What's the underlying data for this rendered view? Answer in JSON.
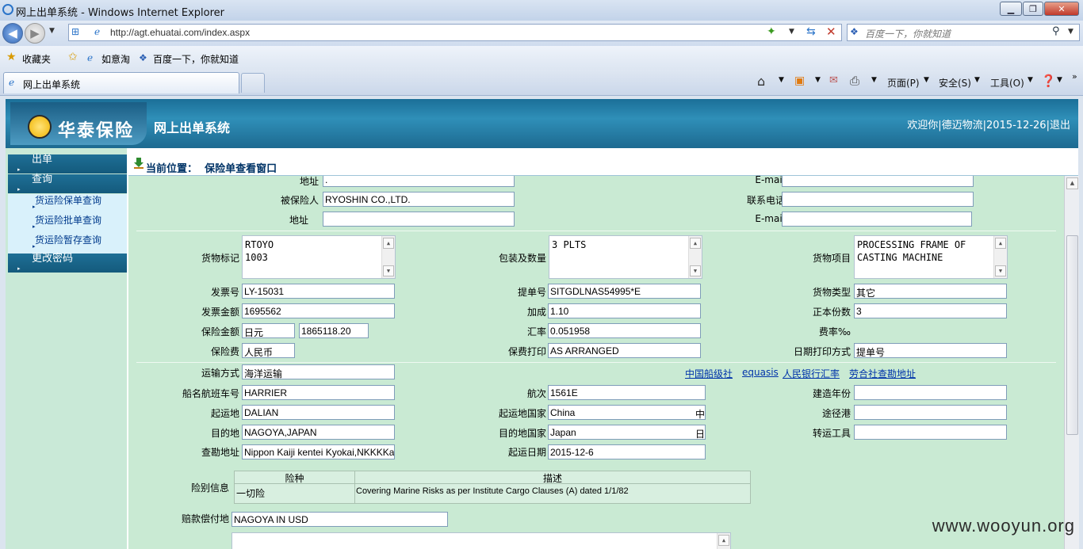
{
  "window": {
    "title": "网上出单系统 - Windows Internet Explorer"
  },
  "address": {
    "url": "http://agt.ehuatai.com/index.aspx"
  },
  "search": {
    "placeholder": "百度一下，你就知道"
  },
  "favorites": {
    "label": "收藏夹",
    "items": [
      "如意淘",
      "百度一下，你就知道"
    ]
  },
  "tab": {
    "label": "网上出单系统"
  },
  "commands": {
    "page": "页面(P)",
    "safety": "安全(S)",
    "tools": "工具(O)"
  },
  "banner": {
    "logo_text": "华泰保险",
    "system_title": "网上出单系统",
    "welcome": "欢迎你",
    "company": "德迈物流",
    "date": "2015-12-26",
    "logout": "退出"
  },
  "sidebar": {
    "menu": [
      "出单",
      "查询",
      "更改密码"
    ],
    "sub": [
      "货运险保单查询",
      "货运险批单查询",
      "货运险暂存查询"
    ]
  },
  "breadcrumb": {
    "prefix": "当前位置：",
    "location": "保险单查看窗口"
  },
  "form": {
    "top_address_label": "地址",
    "top_address_value": ".",
    "top_email_label": "E-mail",
    "insured_label": "被保险人",
    "insured_value": "RYOSHIN CO.,LTD.",
    "phone_label": "联系电话",
    "address_label": "地址",
    "email_label": "E-mail",
    "marks_label": "货物标记",
    "marks_value": "RTOYO\n1003",
    "packing_label": "包装及数量",
    "packing_value": "3 PLTS",
    "goods_label": "货物项目",
    "goods_value": "PROCESSING FRAME OF\nCASTING MACHINE",
    "invoice_no_label": "发票号",
    "invoice_no_value": "LY-15031",
    "bl_label": "提单号",
    "bl_value": "SITGDLNAS54995*E",
    "cargo_type_label": "货物类型",
    "cargo_type_value": "其它",
    "invoice_amount_label": "发票金额",
    "invoice_amount_value": "1695562",
    "markup_label": "加成",
    "markup_value": "1.10",
    "originals_label": "正本份数",
    "originals_value": "3",
    "insured_amount_label": "保险金额",
    "insured_currency": "日元",
    "insured_amount_value": "1865118.20",
    "rate_label": "汇率",
    "rate_value": "0.051958",
    "premium_rate_label": "费率‰",
    "premium_label": "保险费",
    "premium_currency": "人民币",
    "premium_print_label": "保费打印",
    "premium_print_value": "AS ARRANGED",
    "date_print_label": "日期打印方式",
    "date_print_value": "提单号",
    "transport_label": "运输方式",
    "transport_value": "海洋运输",
    "links": [
      "中国船级社",
      "equasis",
      "人民银行汇率",
      "劳合社查勘地址"
    ],
    "vessel_label": "船名航班车号",
    "vessel_value": "HARRIER",
    "voyage_label": "航次",
    "voyage_value": "1561E",
    "built_year_label": "建造年份",
    "origin_label": "起运地",
    "origin_value": "DALIAN",
    "origin_country_label": "起运地国家",
    "origin_country_value": "China",
    "origin_country_suffix": "中",
    "via_label": "途径港",
    "dest_label": "目的地",
    "dest_value": "NAGOYA,JAPAN",
    "dest_country_label": "目的地国家",
    "dest_country_value": "Japan",
    "dest_country_suffix": "日",
    "transship_label": "转运工具",
    "survey_label": "查勘地址",
    "survey_value": "Nippon Kaiji kentei Kyokai,NKKKKa",
    "departure_label": "起运日期",
    "departure_value": "2015-12-6",
    "risk_label": "险别信息",
    "risk_headers": [
      "险种",
      "描述"
    ],
    "risk_row": {
      "type": "一切险",
      "desc": "Covering Marine Risks as per Institute Cargo Clauses (A) dated 1/1/82"
    },
    "claim_label": "赔款偿付地",
    "claim_value": "NAGOYA IN USD"
  },
  "watermark": "www.wooyun.org",
  "colors": {
    "banner": "#1d6f98",
    "sidebar": "#c9e9d7",
    "content": "#c9ead3",
    "link": "#0033aa"
  }
}
